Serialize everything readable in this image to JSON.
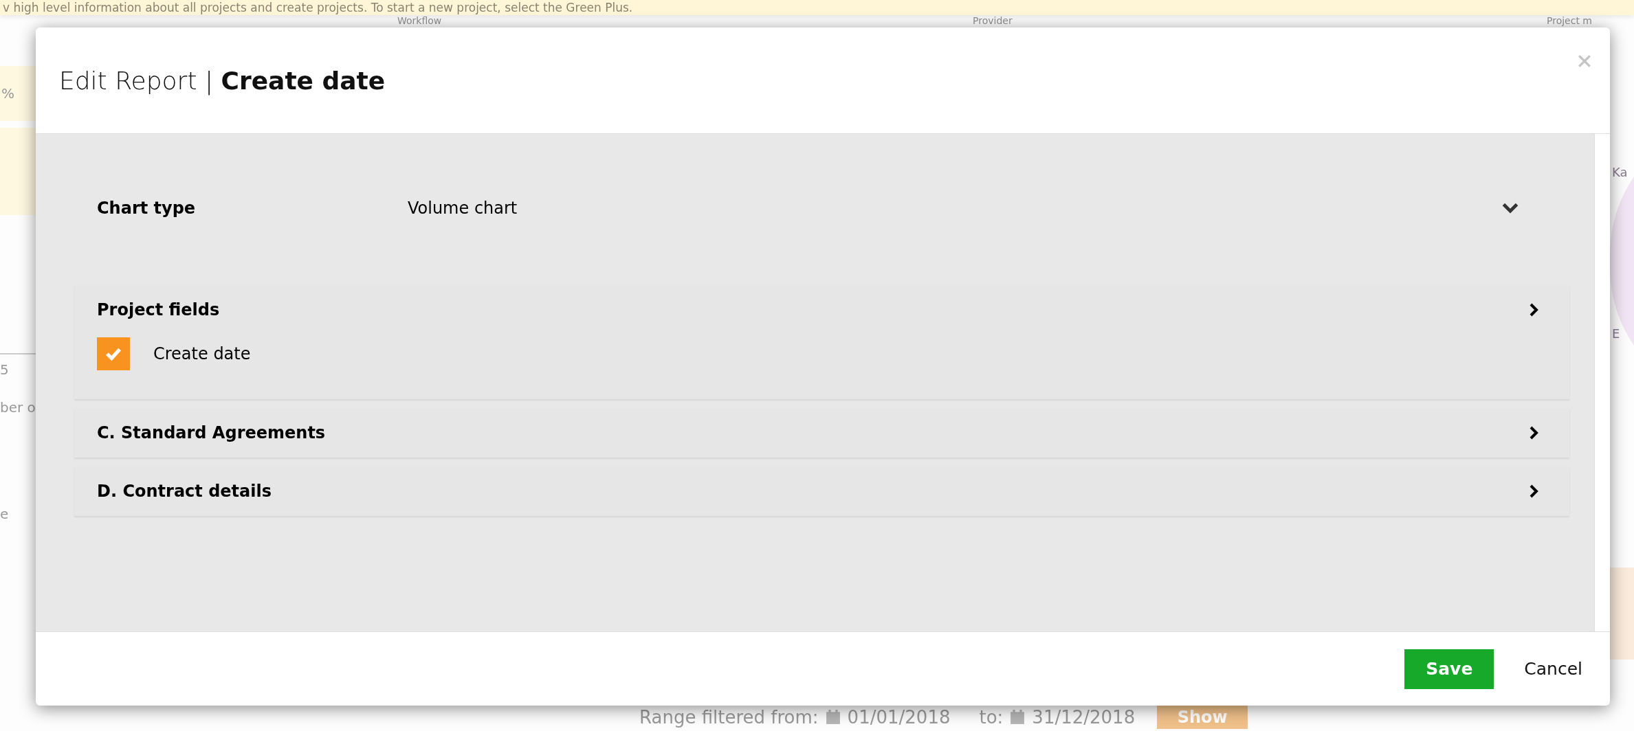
{
  "background": {
    "banner": "v high level information about all projects and create projects. To start a new project, select the Green Plus.",
    "columns": [
      "Workflow",
      "Provider",
      "Project m"
    ],
    "left_fragments": [
      "%",
      "5",
      "ber o",
      "e"
    ],
    "pie_labels": [
      "Ka",
      "E"
    ],
    "range": {
      "label": "Range filtered from:",
      "from": "01/01/2018",
      "to_label": "to:",
      "to": "31/12/2018",
      "button": "Show"
    }
  },
  "dialog": {
    "title": "Edit Report",
    "separator": "|",
    "subtitle": "Create date",
    "chart_type": {
      "label": "Chart type",
      "value": "Volume chart"
    },
    "sections": [
      {
        "title": "Project fields",
        "expanded": true,
        "fields": [
          {
            "label": "Create date",
            "checked": true
          }
        ]
      },
      {
        "title": "C. Standard Agreements",
        "expanded": false
      },
      {
        "title": "D. Contract details",
        "expanded": false
      }
    ],
    "buttons": {
      "save": "Save",
      "cancel": "Cancel"
    }
  }
}
